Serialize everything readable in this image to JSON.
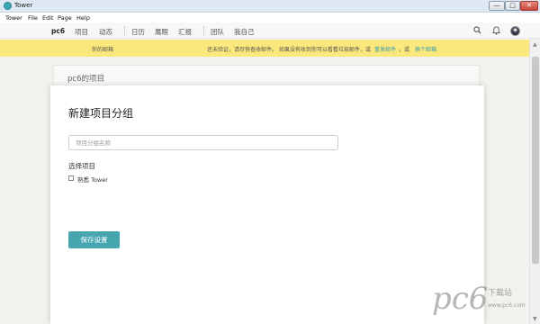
{
  "window": {
    "title": "Tower",
    "min_glyph": "—",
    "max_glyph": "□",
    "close_glyph": "✕"
  },
  "menubar": {
    "items": [
      "Tower",
      "File",
      "Edit",
      "Page",
      "Help"
    ]
  },
  "appbar": {
    "team": "pc6",
    "nav": [
      "项目",
      "动态",
      "日历",
      "鹰眼",
      "汇报",
      "团队",
      "我自己"
    ]
  },
  "notice": {
    "email": "你的邮箱",
    "message": "还未验证，请尽快查收邮件。 如果没有收到你可以看看垃圾邮件，或",
    "resend": "重发邮件",
    "or": "，或",
    "change": "换个邮箱"
  },
  "project_card": {
    "name": "pc6的项目"
  },
  "dialog": {
    "title": "新建项目分组",
    "input_placeholder": "项目分组名称",
    "input_value": "",
    "select_label": "选择项目",
    "projects": [
      {
        "label": "熟悉 Tower",
        "checked": false
      }
    ],
    "save_label": "保存设置"
  },
  "watermark": {
    "logo": "pc6",
    "tagline": "下载站",
    "url": "www.pc6.com"
  },
  "colors": {
    "accent": "#46a6b0",
    "notice_bg": "#fbe87c",
    "link": "#3a9ba8"
  }
}
